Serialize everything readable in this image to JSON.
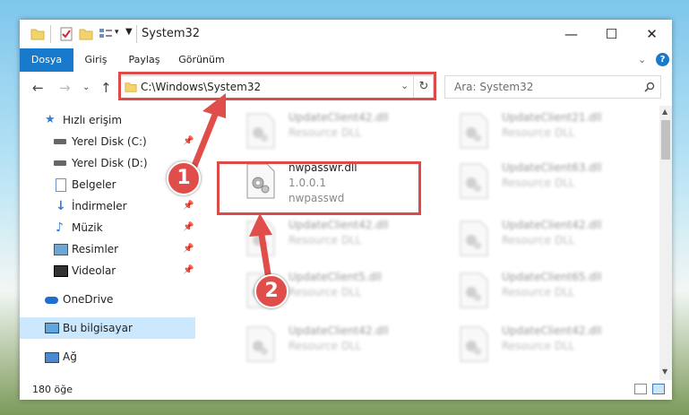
{
  "window": {
    "title": "System32",
    "controls": {
      "minimize": "—",
      "maximize": "☐",
      "close": "✕"
    }
  },
  "ribbon": {
    "tabs": [
      {
        "label": "Dosya",
        "active": true
      },
      {
        "label": "Giriş"
      },
      {
        "label": "Paylaş"
      },
      {
        "label": "Görünüm"
      }
    ]
  },
  "address": {
    "path": "C:\\Windows\\System32",
    "search_placeholder": "Ara: System32"
  },
  "sidebar": {
    "items": [
      {
        "label": "Hızlı erişim",
        "icon": "star-icon"
      },
      {
        "label": "Yerel Disk (C:)",
        "icon": "drive-icon",
        "pinned": true
      },
      {
        "label": "Yerel Disk (D:)",
        "icon": "drive-icon"
      },
      {
        "label": "Belgeler",
        "icon": "documents-icon",
        "pinned": true
      },
      {
        "label": "İndirmeler",
        "icon": "download-icon",
        "pinned": true
      },
      {
        "label": "Müzik",
        "icon": "music-icon",
        "pinned": true
      },
      {
        "label": "Resimler",
        "icon": "pictures-icon",
        "pinned": true
      },
      {
        "label": "Videolar",
        "icon": "videos-icon",
        "pinned": true
      },
      {
        "label": "OneDrive",
        "icon": "cloud-icon"
      },
      {
        "label": "Bu bilgisayar",
        "icon": "computer-icon",
        "selected": true
      },
      {
        "label": "Ağ",
        "icon": "network-icon"
      }
    ]
  },
  "files": [
    {
      "name": "UpdateClient42.dll",
      "desc": "Resource DLL"
    },
    {
      "name": "UpdateClient21.dll",
      "desc": "Resource DLL"
    },
    {
      "name": "nwpasswr.dll",
      "version": "1.0.0.1",
      "desc": "nwpasswd",
      "highlighted": true
    },
    {
      "name": "UpdateClient63.dll",
      "desc": "Resource DLL"
    },
    {
      "name": "UpdateClient42.dll",
      "desc": "Resource DLL"
    },
    {
      "name": "UpdateClient42.dll",
      "desc": "Resource DLL"
    },
    {
      "name": "UpdateClient5.dll",
      "desc": "Resource DLL"
    },
    {
      "name": "UpdateClient65.dll",
      "desc": "Resource DLL"
    },
    {
      "name": "UpdateClient42.dll",
      "desc": "Resource DLL"
    },
    {
      "name": "UpdateClient42.dll",
      "desc": "Resource DLL"
    }
  ],
  "status": {
    "count": "180 öğe"
  },
  "annotations": {
    "step1": "1",
    "step2": "2",
    "color": "#e04e4b"
  }
}
